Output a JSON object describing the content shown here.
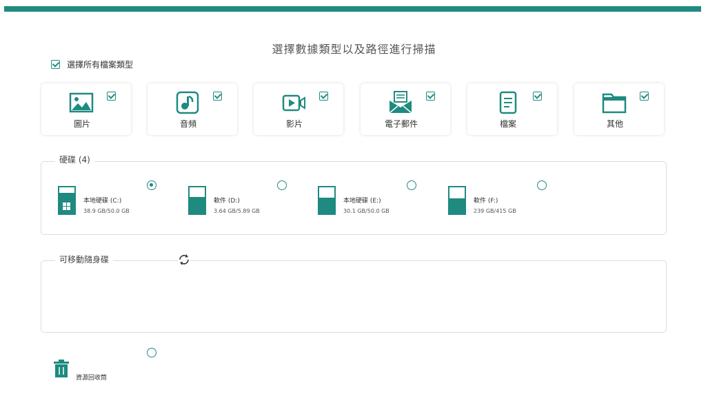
{
  "header": {
    "title": "選擇數據類型以及路徑進行掃描"
  },
  "select_all": {
    "label": "選擇所有檔案類型",
    "checked": true
  },
  "file_types": [
    {
      "label": "圖片",
      "icon": "image-icon",
      "checked": true
    },
    {
      "label": "音頻",
      "icon": "music-icon",
      "checked": true
    },
    {
      "label": "影片",
      "icon": "video-icon",
      "checked": true
    },
    {
      "label": "電子郵件",
      "icon": "email-icon",
      "checked": true
    },
    {
      "label": "檔案",
      "icon": "document-icon",
      "checked": true
    },
    {
      "label": "其他",
      "icon": "folder-icon",
      "checked": true
    }
  ],
  "hard_drives": {
    "title": "硬碟 (4)",
    "drives": [
      {
        "name": "本地硬碟 (C:)",
        "size": "38.9 GB/50.0 GB",
        "used_fraction": 0.78,
        "system": true,
        "selected": true
      },
      {
        "name": "軟件 (D:)",
        "size": "3.64 GB/5.89 GB",
        "used_fraction": 0.62,
        "system": false,
        "selected": false
      },
      {
        "name": "本地硬碟 (E:)",
        "size": "30.1 GB/50.0 GB",
        "used_fraction": 0.6,
        "system": false,
        "selected": false
      },
      {
        "name": "軟件 (F:)",
        "size": "239 GB/415 GB",
        "used_fraction": 0.58,
        "system": false,
        "selected": false
      }
    ]
  },
  "removable": {
    "title": "可移動隨身碟"
  },
  "recycle_bin": {
    "label": "資源回收筒",
    "selected": false
  },
  "colors": {
    "accent": "#1e8a80"
  }
}
